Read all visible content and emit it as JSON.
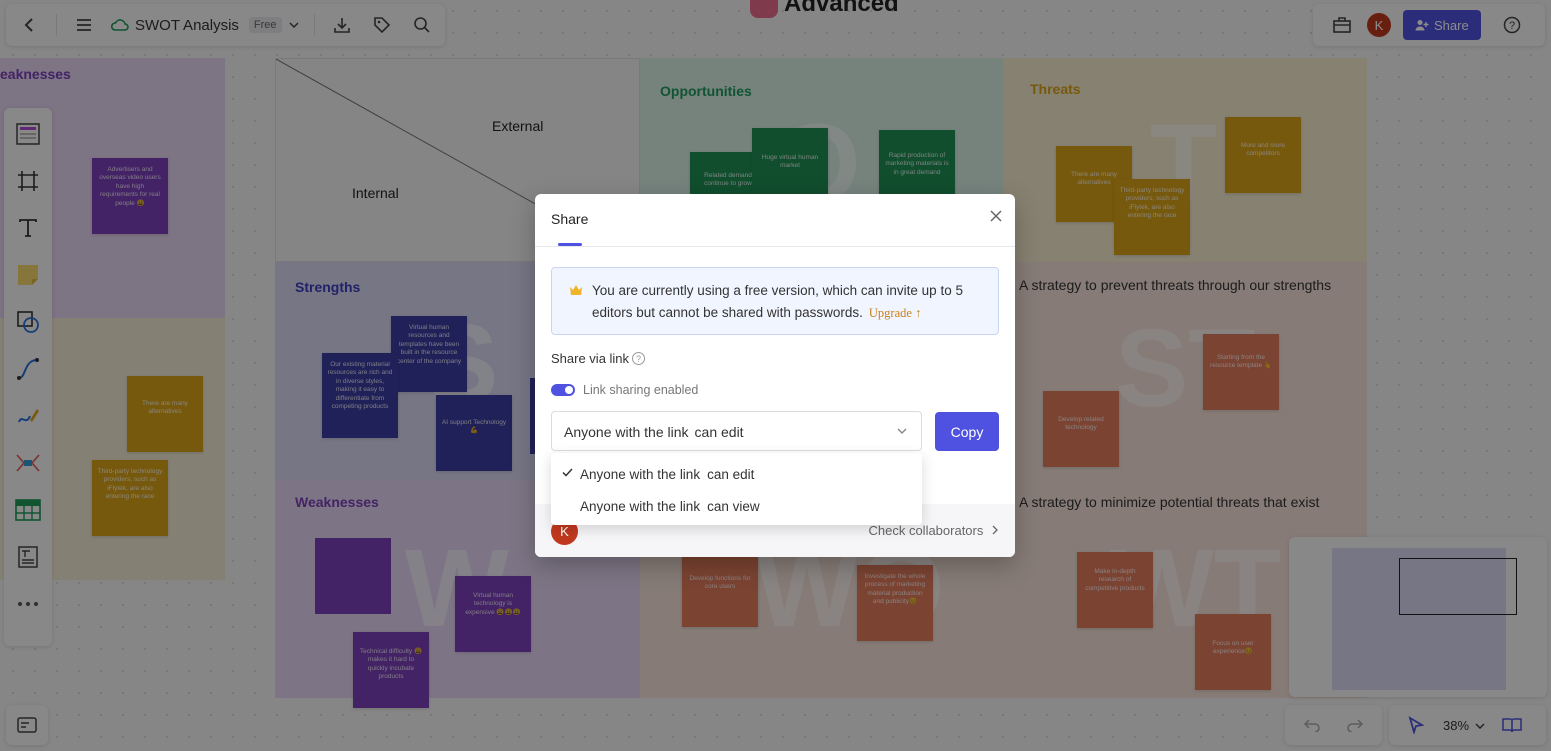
{
  "top_center_title": "Advanced",
  "toolbar": {
    "doc_title": "SWOT Analysis",
    "plan_badge": "Free"
  },
  "header_right": {
    "avatar_initial": "K",
    "share_label": "Share"
  },
  "canvas": {
    "left_partial_title": "eaknesses",
    "matrix_external": "External",
    "matrix_internal": "Internal",
    "quadrants": {
      "opportunities": "Opportunities",
      "threats": "Threats",
      "strengths": "Strengths",
      "weaknesses": "Weaknesses",
      "st_strategy": "A strategy to prevent threats through our strengths",
      "wt_strategy": "A strategy to minimize potential threats that exist"
    },
    "big_letters": {
      "o": "O",
      "t": "T",
      "s": "S",
      "st": "ST",
      "w": "W",
      "wo": "WO",
      "wt": "WT"
    },
    "stickies": {
      "adv": "Advertisers and overseas video users have high requirements for real people 😩",
      "left_many_alt": "There are many alternatives",
      "left_third_party": "Third-party technology providers, such as iFlytek, are also entering the race",
      "related_demand": "Related demand continue to grow",
      "huge_market": "Huge virtual human market",
      "rapid_production": "Rapid production of marketing materials is in great demand",
      "many_alt": "There are many alternatives",
      "third_party": "Third-party technology providers, such as iFlytek, are also entering the race",
      "more_competitors": "More and more competitors",
      "virtual_resources": "Virtual human resources and templates have been built in the resource center of the company",
      "existing_material": "Our existing material resources are rich and in diverse styles, making it easy to differentiate from competing products",
      "ai_support": "AI support Technology💪",
      "starting_template": "Starting from the resource template 👆",
      "develop_tech": "Develop related technology",
      "vh_expensive": "Virtual human technology is expensive 😩😩😩",
      "tech_difficulty": "Technical difficulty 😩 makes it hard to quickly incubate products",
      "develop_functions": "Develop functions for core users",
      "investigate": "Investigate the whole process of marketing material production and publicity😊",
      "research": "Make in-depth research of competitive products",
      "focus_ux": "Focus on user experience😊"
    }
  },
  "bottom": {
    "zoom": "38%"
  },
  "share_modal": {
    "title": "Share",
    "notice_text": "You are currently using a free version, which can invite up to 5 editors but cannot be shared with passwords.",
    "upgrade_label": "Upgrade",
    "share_via_link": "Share via link",
    "toggle_label": "Link sharing enabled",
    "link_toggle_on": true,
    "select": {
      "prefix": "Anyone with the link",
      "permission": "can edit"
    },
    "copy_label": "Copy",
    "options": [
      {
        "prefix": "Anyone with the link",
        "permission": "can edit",
        "selected": true
      },
      {
        "prefix": "Anyone with the link",
        "permission": "can view",
        "selected": false
      }
    ],
    "footer_avatar": "K",
    "check_collaborators": "Check collaborators"
  },
  "colors": {
    "accent": "#4f52e0",
    "avatar": "#c0391e",
    "opportunities": "#1f9a5a",
    "threats": "#d9a21a",
    "strengths": "#3d3dbf",
    "weaknesses": "#7b3fb8"
  }
}
